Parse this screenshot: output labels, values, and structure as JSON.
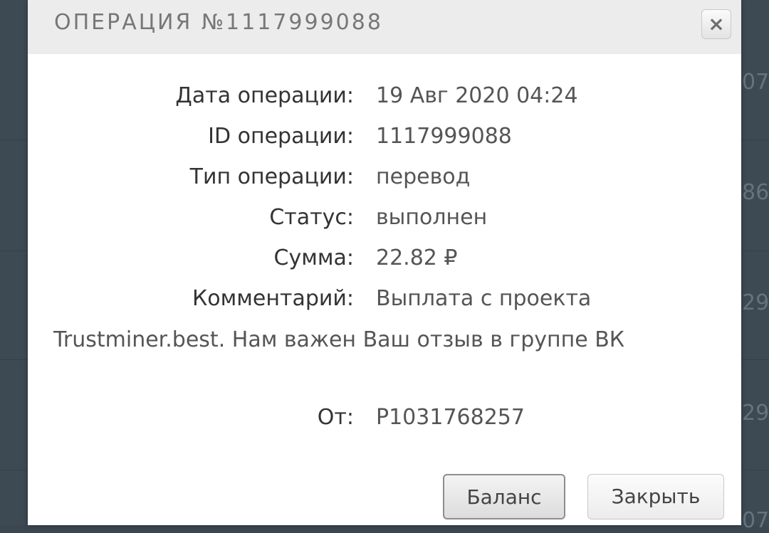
{
  "background": {
    "partial_digits": [
      "07",
      "86",
      "29",
      "29",
      "07"
    ]
  },
  "modal": {
    "title": "ОПЕРАЦИЯ №1117999088",
    "close_icon": "×",
    "fields": {
      "date": {
        "label": "Дата операции:",
        "value": "19 Авг 2020 04:24"
      },
      "id": {
        "label": "ID операции:",
        "value": "1117999088"
      },
      "type": {
        "label": "Тип операции:",
        "value": "перевод"
      },
      "status": {
        "label": "Статус:",
        "value": "выполнен"
      },
      "amount": {
        "label": "Сумма:",
        "value": "22.82 ₽"
      },
      "comment": {
        "label": "Комментарий:",
        "value": "Выплата с проекта",
        "continuation": "Trustminer.best. Нам важен Ваш отзыв в группе ВК"
      },
      "from": {
        "label": "От:",
        "value": "P1031768257"
      }
    },
    "buttons": {
      "balance": "Баланс",
      "close": "Закрыть"
    }
  },
  "colors": {
    "backdrop": "#3d4953",
    "header_bg": "#ececec",
    "title_text": "#777777",
    "label_text": "#333333",
    "value_text": "#555555"
  }
}
